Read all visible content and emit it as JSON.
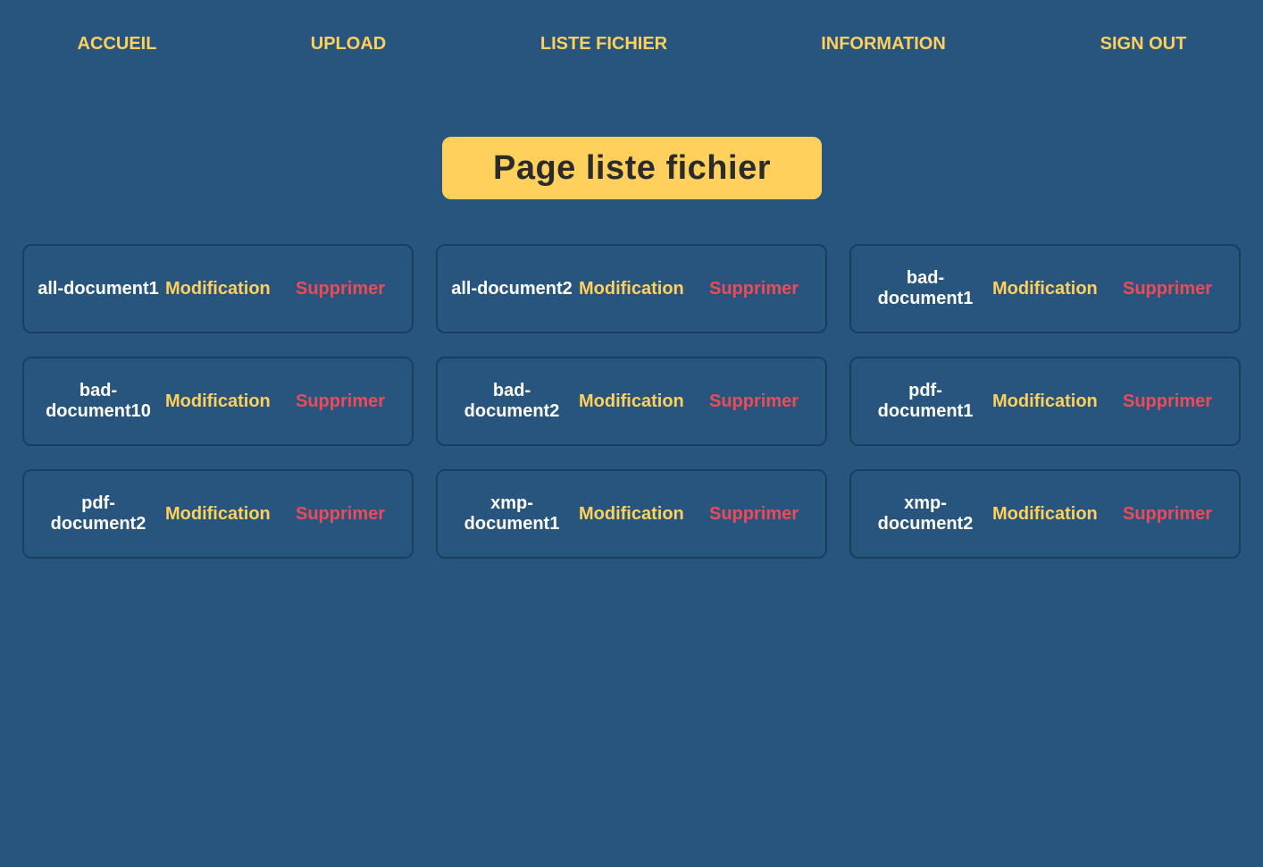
{
  "nav": {
    "items": [
      {
        "label": "ACCUEIL"
      },
      {
        "label": "UPLOAD"
      },
      {
        "label": "LISTE FICHIER"
      },
      {
        "label": "INFORMATION"
      },
      {
        "label": "SIGN OUT"
      }
    ]
  },
  "page": {
    "title": "Page liste fichier"
  },
  "files": [
    {
      "name": "all-document1",
      "edit_label": "Modification",
      "delete_label": "Supprimer"
    },
    {
      "name": "all-document2",
      "edit_label": "Modification",
      "delete_label": "Supprimer"
    },
    {
      "name": "bad-\ndocument1",
      "edit_label": "Modification",
      "delete_label": "Supprimer"
    },
    {
      "name": "bad-\ndocument10",
      "edit_label": "Modification",
      "delete_label": "Supprimer"
    },
    {
      "name": "bad-\ndocument2",
      "edit_label": "Modification",
      "delete_label": "Supprimer"
    },
    {
      "name": "pdf-\ndocument1",
      "edit_label": "Modification",
      "delete_label": "Supprimer"
    },
    {
      "name": "pdf-\ndocument2",
      "edit_label": "Modification",
      "delete_label": "Supprimer"
    },
    {
      "name": "xmp-\ndocument1",
      "edit_label": "Modification",
      "delete_label": "Supprimer"
    },
    {
      "name": "xmp-\ndocument2",
      "edit_label": "Modification",
      "delete_label": "Supprimer"
    }
  ],
  "colors": {
    "background": "#27557d",
    "accent": "#ffd05c",
    "danger": "#ee4a57",
    "card_border": "#1a3f5e"
  }
}
